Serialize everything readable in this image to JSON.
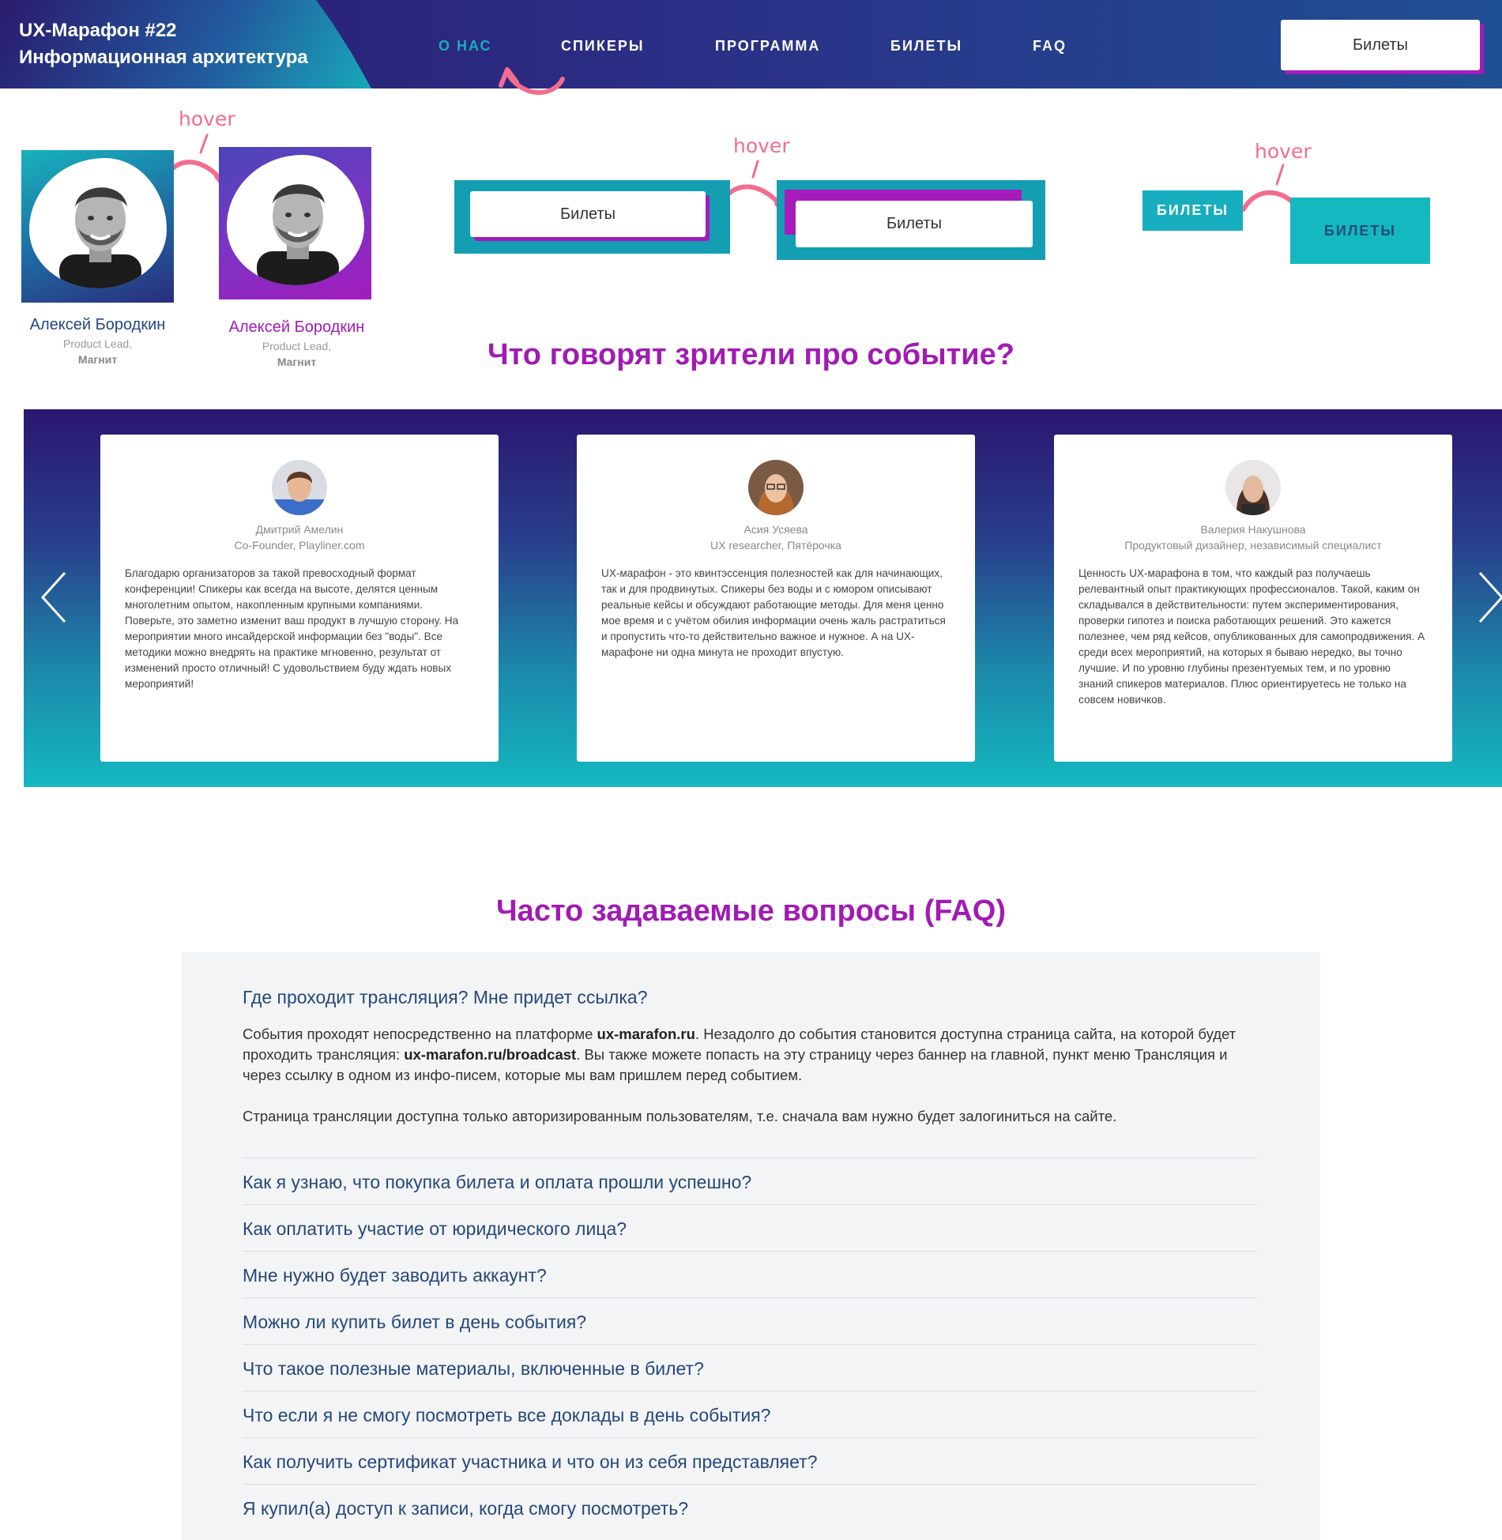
{
  "header": {
    "brand_line1": "UX-Марафон #22",
    "brand_line2": "Информационная архитектура",
    "nav": [
      "О НАС",
      "СПИКЕРЫ",
      "ПРОГРАММА",
      "БИЛЕТЫ",
      "FAQ"
    ],
    "active_nav": "О НАС",
    "tickets_button": "Билеты"
  },
  "hover_labels": [
    "hover",
    "hover",
    "hover"
  ],
  "speakers": [
    {
      "name": "Алексей Бородкин",
      "role": "Product Lead,",
      "company": "Магнит",
      "state": "default"
    },
    {
      "name": "Алексей Бородкин",
      "role": "Product Lead,",
      "company": "Магнит",
      "state": "hover"
    }
  ],
  "ticket_states": {
    "default_label": "Билеты",
    "hover_label": "Билеты",
    "tag_default": "БИЛЕТЫ",
    "tag_hover": "БИЛЕТЫ"
  },
  "reviews_section": {
    "title": "Что говорят зрители про событие?",
    "items": [
      {
        "name": "Дмитрий Амелин",
        "role": "Co-Founder, Playliner.com",
        "text": "Благодарю организаторов за такой превосходный формат конференции! Спикеры как всегда на высоте, делятся ценным многолетним опытом, накопленным крупными компаниями. Поверьте, это заметно изменит ваш продукт в лучшую сторону. На мероприятии много инсайдерской информации без \"воды\". Все методики можно внедрять на практике мгновенно, результат от изменений просто отличный! С удовольствием буду ждать новых мероприятий!"
      },
      {
        "name": "Асия Усяева",
        "role": "UX researcher, Пятёрочка",
        "text": "UX-марафон - это квинтэссенция полезностей как для начинающих, так и для продвинутых. Спикеры без воды и с юмором описывают реальные кейсы и обсуждают работающие методы. Для меня ценно мое время и с учётом обилия информации очень жаль растратиться и пропустить что-то действительно важное и нужное. А на UX-марафоне ни одна минута не проходит впустую."
      },
      {
        "name": "Валерия Накушнова",
        "role": "Продуктовый дизайнер, независимый специалист",
        "text": "Ценность UX-марафона в том, что каждый раз получаешь релевантный опыт практикующих профессионалов. Такой, каким он складывался в действительности: путем экспериментирования, проверки гипотез и поиска работающих решений. Это кажется полезнее, чем ряд кейсов, опубликованных для самопродвижения. А среди всех мероприятий, на которых я бываю нередко, вы точно лучшие. И по уровню глубины презентуемых тем, и по уровню знаний спикеров материалов. Плюс ориентируетесь не только на совсем новичков."
      }
    ]
  },
  "faq": {
    "title": "Часто задаваемые вопросы (FAQ)",
    "open_question": "Где проходит трансляция? Мне придет ссылка?",
    "answer_p1_a": "События проходят непосредственно на платформе ",
    "answer_p1_link1": "ux-marafon.ru",
    "answer_p1_b": ". Незадолго до события становится доступна страница сайта, на которой будет проходить трансляция: ",
    "answer_p1_link2": "ux-marafon.ru/broadcast",
    "answer_p1_c": ". Вы также можете попасть на эту страницу через баннер на главной, пункт меню Трансляция и через ссылку в одном из инфо-писем, которые мы вам пришлем перед событием.",
    "answer_p2": "Страница трансляции доступна только авторизированным пользователям, т.е. сначала вам нужно будет залогиниться на сайте.",
    "questions": [
      "Как я узнаю, что покупка билета и оплата прошли успешно?",
      "Как оплатить участие от юридического лица?",
      "Мне нужно будет заводить аккаунт?",
      "Можно ли купить билет в день события?",
      "Что такое полезные материалы, включенные в билет?",
      "Что если я не смогу посмотреть все доклады в день события?",
      "Как получить сертификат участника и что он из себя представляет?",
      "Я купил(а) доступ к записи, когда смогу посмотреть?"
    ]
  },
  "colors": {
    "accent_purple": "#a51bbc",
    "accent_teal": "#17aebf",
    "hover_pink": "#f26d8f",
    "faq_text": "#26477a"
  }
}
